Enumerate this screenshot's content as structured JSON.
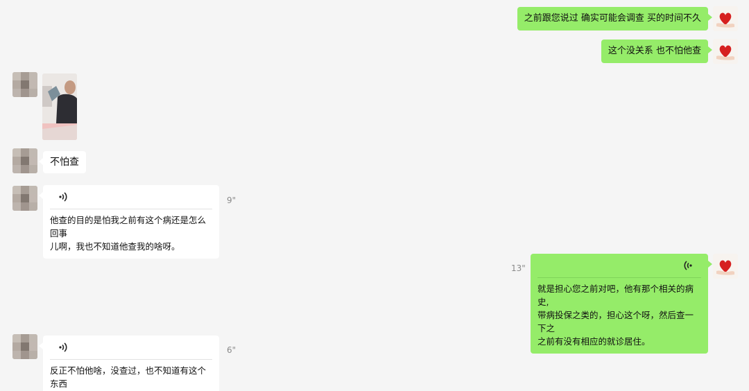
{
  "messages": [
    {
      "side": "right",
      "type": "text",
      "text": "之前跟您说过  确实可能会调查 买的时间不久"
    },
    {
      "side": "right",
      "type": "text",
      "text": "这个没关系  也不怕他查"
    },
    {
      "side": "left",
      "type": "image"
    },
    {
      "side": "left",
      "type": "text",
      "text": "不怕查"
    },
    {
      "side": "left",
      "type": "voice",
      "duration": "9\"",
      "transcript_lines": [
        "他查的目的是怕我之前有这个病还是怎么回事",
        "儿啊，我也不知道他查我的啥呀。"
      ]
    },
    {
      "side": "right",
      "type": "voice",
      "duration": "13\"",
      "transcript_lines": [
        "就是担心您之前对吧，他有那个相关的病史,",
        "带病投保之类的，担心这个呀，然后查一下之",
        "之前有没有相应的就诊居住。"
      ]
    },
    {
      "side": "left",
      "type": "voice",
      "duration": "6\"",
      "transcript_lines": [
        "反正不怕他啥，没查过，也不知道有这个东西",
        "。"
      ]
    }
  ],
  "icons": {
    "voice_left": "voice-wave-icon",
    "voice_right": "voice-wave-icon",
    "self_avatar": "red-heart-hand-icon",
    "peer_avatar": "blurred-avatar"
  },
  "colors": {
    "background": "#f5f5f5",
    "self_bubble": "#95ec69",
    "peer_bubble": "#ffffff",
    "duration_text": "#8a8a8a"
  }
}
